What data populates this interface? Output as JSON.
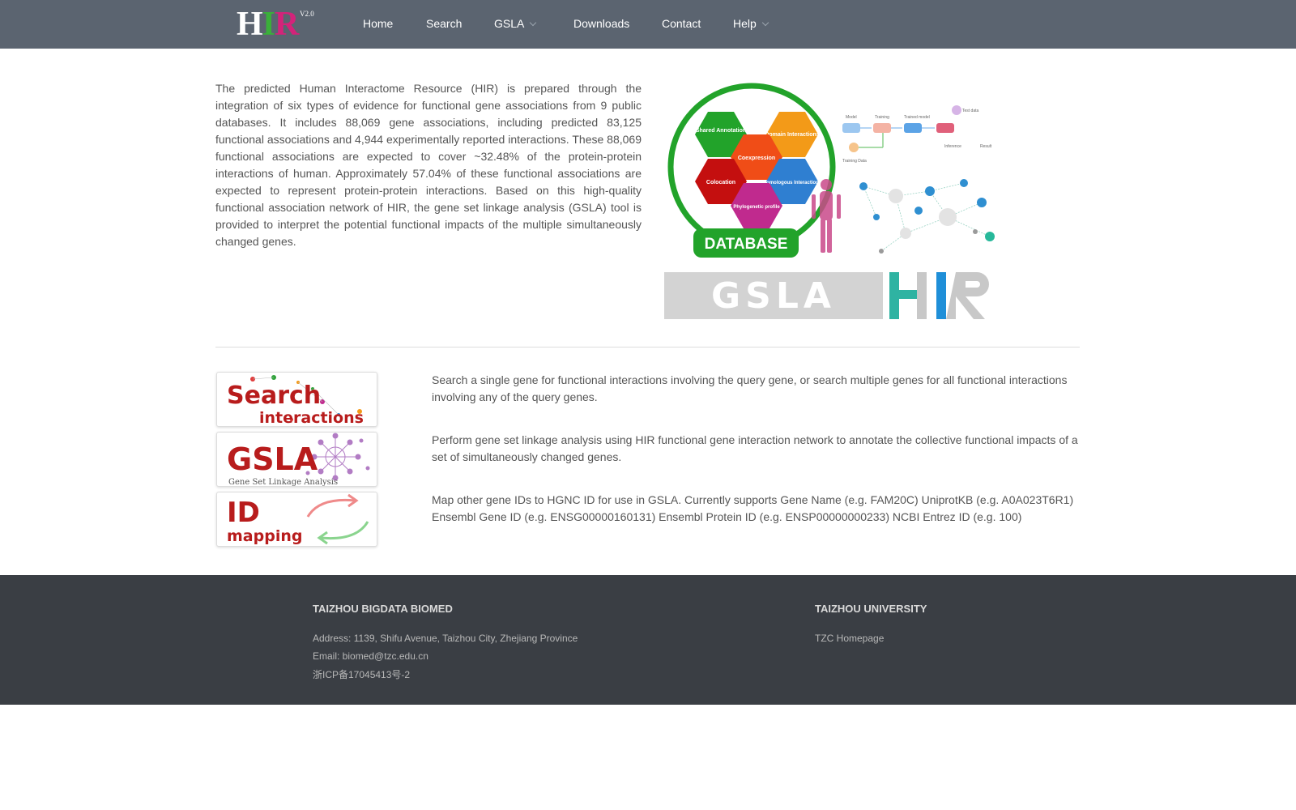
{
  "logo": {
    "h": "H",
    "i": "I",
    "r": "R",
    "version": "V2.0"
  },
  "nav": {
    "home": "Home",
    "search": "Search",
    "gsla": "GSLA",
    "downloads": "Downloads",
    "contact": "Contact",
    "help": "Help"
  },
  "intro": "The predicted Human Interactome Resource (HIR) is prepared through the integration of six types of evidence for functional gene associations from 9 public databases. It includes 88,069 gene associations, including predicted 83,125 functional associations and 4,944 experimentally reported interactions. These 88,069 functional associations are expected to cover ~32.48% of the protein-protein interactions of human. Approximately 57.04% of these functional associations are expected to represent protein-protein interactions. Based on this high-quality functional association network of HIR, the gene set linkage analysis (GSLA) tool is provided to interpret the potential functional impacts of the multiple simultaneously changed genes.",
  "hero": {
    "hex": [
      "Shared Annotation",
      "Domain Interactions",
      "Coexpression",
      "Colocation",
      "Homologous Interactions",
      "Phylogenetic profile"
    ],
    "database": "DATABASE",
    "model_labels": [
      "Model",
      "Training",
      "Trained model",
      "Test data",
      "Training Data",
      "Inference",
      "Result"
    ],
    "gsla_banner": "GSLA",
    "hir_banner": "HIR"
  },
  "features": {
    "search_card": {
      "line1": "Search",
      "line2": "interactions"
    },
    "gsla_card": {
      "title": "GSLA",
      "subtitle": "Gene Set Linkage Analysis"
    },
    "id_card": {
      "title": "ID",
      "subtitle": "mapping"
    },
    "search_desc": "Search a single gene for functional interactions involving the query gene, or search multiple genes for all functional interactions involving any of the query genes.",
    "gsla_desc": "Perform gene set linkage analysis using HIR functional gene interaction network to annotate the collective functional impacts of a set of simultaneously changed genes.",
    "id_desc": "Map other gene IDs to HGNC ID for use in GSLA. Currently supports Gene Name (e.g. FAM20C) UniprotKB (e.g. A0A023T6R1) Ensembl Gene ID (e.g. ENSG00000160131) Ensembl Protein ID (e.g. ENSP00000000233) NCBI Entrez ID (e.g. 100)"
  },
  "footer": {
    "left_title": "TAIZHOU BIGDATA BIOMED",
    "address": "Address: 1139, Shifu Avenue, Taizhou City, Zhejiang Province",
    "email": "Email: biomed@tzc.edu.cn",
    "icp": "浙ICP备17045413号-2",
    "right_title": "TAIZHOU UNIVERSITY",
    "homepage": "TZC Homepage"
  },
  "colors": {
    "navbar": "#5b6470",
    "footer": "#3a3e44",
    "green": "#22a32a",
    "red": "#c40f0f",
    "orange": "#f39a18",
    "magenta": "#c02a8e",
    "blue": "#2f7fd1"
  }
}
